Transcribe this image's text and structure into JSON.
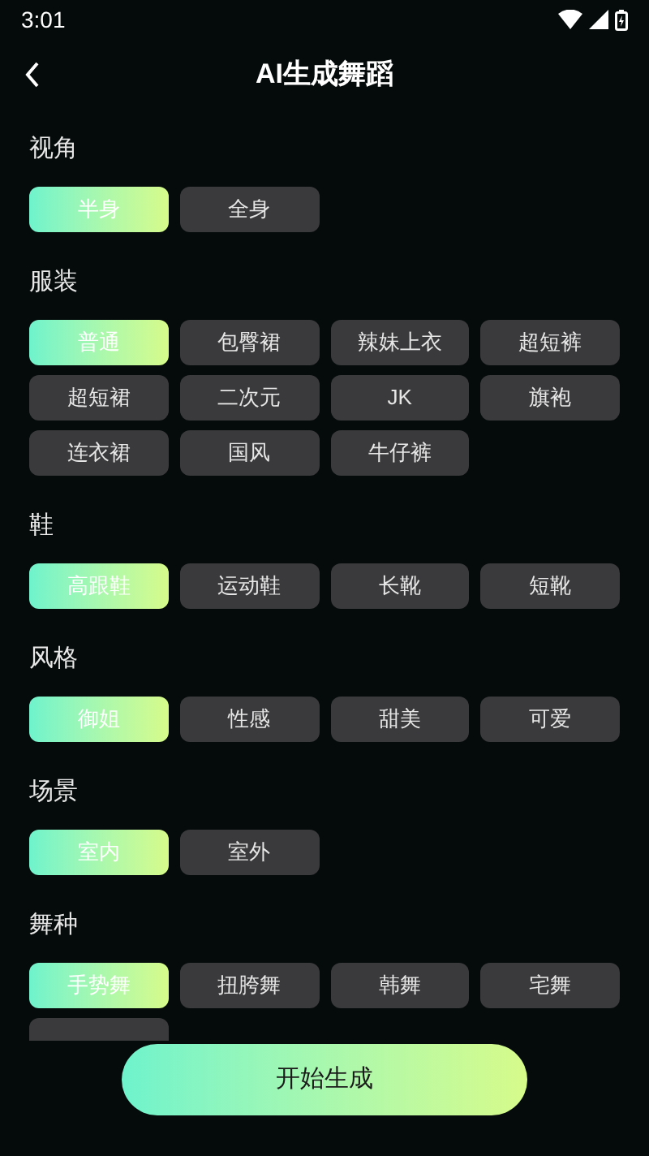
{
  "status_bar": {
    "time": "3:01"
  },
  "header": {
    "title": "AI生成舞蹈"
  },
  "sections": [
    {
      "title": "视角",
      "options": [
        {
          "label": "半身",
          "selected": true
        },
        {
          "label": "全身",
          "selected": false
        }
      ]
    },
    {
      "title": "服装",
      "options": [
        {
          "label": "普通",
          "selected": true
        },
        {
          "label": "包臀裙",
          "selected": false
        },
        {
          "label": "辣妹上衣",
          "selected": false
        },
        {
          "label": "超短裤",
          "selected": false
        },
        {
          "label": "超短裙",
          "selected": false
        },
        {
          "label": "二次元",
          "selected": false
        },
        {
          "label": "JK",
          "selected": false
        },
        {
          "label": "旗袍",
          "selected": false
        },
        {
          "label": "连衣裙",
          "selected": false
        },
        {
          "label": "国风",
          "selected": false
        },
        {
          "label": "牛仔裤",
          "selected": false
        }
      ]
    },
    {
      "title": "鞋",
      "options": [
        {
          "label": "高跟鞋",
          "selected": true
        },
        {
          "label": "运动鞋",
          "selected": false
        },
        {
          "label": "长靴",
          "selected": false
        },
        {
          "label": "短靴",
          "selected": false
        }
      ]
    },
    {
      "title": "风格",
      "options": [
        {
          "label": "御姐",
          "selected": true
        },
        {
          "label": "性感",
          "selected": false
        },
        {
          "label": "甜美",
          "selected": false
        },
        {
          "label": "可爱",
          "selected": false
        }
      ]
    },
    {
      "title": "场景",
      "options": [
        {
          "label": "室内",
          "selected": true
        },
        {
          "label": "室外",
          "selected": false
        }
      ]
    },
    {
      "title": "舞种",
      "options": [
        {
          "label": "手势舞",
          "selected": true
        },
        {
          "label": "扭胯舞",
          "selected": false
        },
        {
          "label": "韩舞",
          "selected": false
        },
        {
          "label": "宅舞",
          "selected": false
        },
        {
          "selected": false
        }
      ]
    }
  ],
  "primary_button": {
    "label": "开始生成"
  }
}
